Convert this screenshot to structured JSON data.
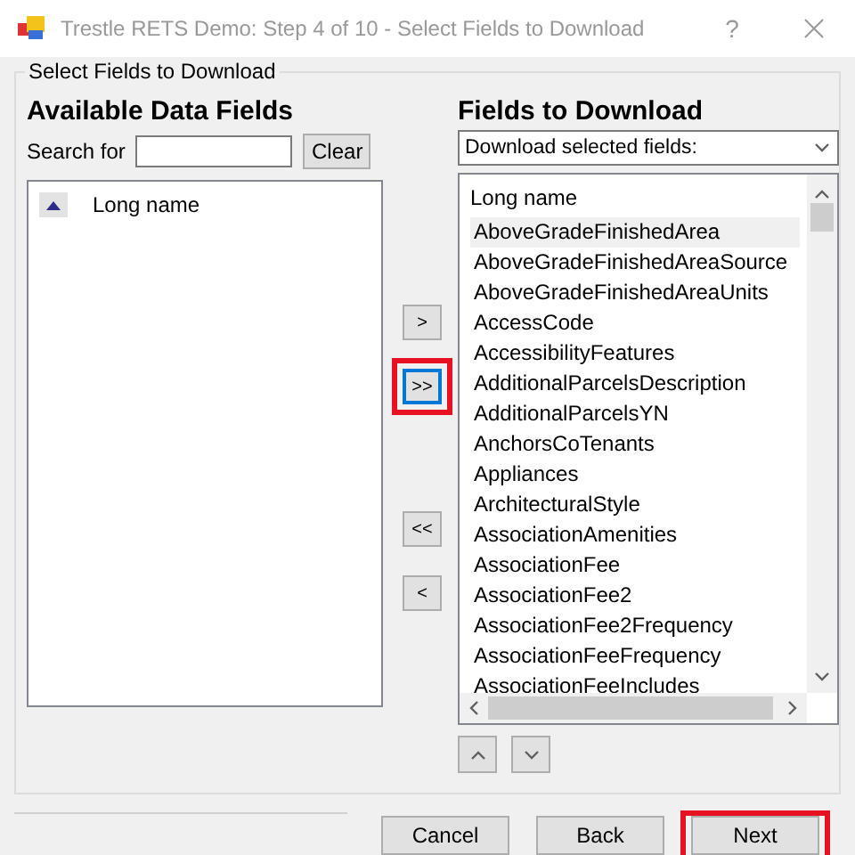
{
  "window": {
    "title": "Trestle RETS Demo: Step 4 of 10 - Select Fields to Download",
    "help": "?"
  },
  "group": {
    "label": "Select Fields to Download"
  },
  "available": {
    "heading": "Available Data Fields",
    "search_label": "Search for",
    "clear_button": "Clear",
    "column": "Long name"
  },
  "transfer_buttons": [
    {
      "label": ">",
      "focused": false,
      "highlighted": false
    },
    {
      "label": ">>",
      "focused": true,
      "highlighted": true
    },
    {
      "label": "<<",
      "focused": false,
      "highlighted": false
    },
    {
      "label": "<",
      "focused": false,
      "highlighted": false
    }
  ],
  "download": {
    "heading": "Fields to Download",
    "dropdown": "Download selected fields:",
    "column": "Long name",
    "rows": [
      {
        "name": "AboveGradeFinishedArea",
        "selected": true
      },
      {
        "name": "AboveGradeFinishedAreaSource",
        "selected": false
      },
      {
        "name": "AboveGradeFinishedAreaUnits",
        "selected": false
      },
      {
        "name": "AccessCode",
        "selected": false
      },
      {
        "name": "AccessibilityFeatures",
        "selected": false
      },
      {
        "name": "AdditionalParcelsDescription",
        "selected": false
      },
      {
        "name": "AdditionalParcelsYN",
        "selected": false
      },
      {
        "name": "AnchorsCoTenants",
        "selected": false
      },
      {
        "name": "Appliances",
        "selected": false
      },
      {
        "name": "ArchitecturalStyle",
        "selected": false
      },
      {
        "name": "AssociationAmenities",
        "selected": false
      },
      {
        "name": "AssociationFee",
        "selected": false
      },
      {
        "name": "AssociationFee2",
        "selected": false
      },
      {
        "name": "AssociationFee2Frequency",
        "selected": false
      },
      {
        "name": "AssociationFeeFrequency",
        "selected": false
      },
      {
        "name": "AssociationFeeIncludes",
        "selected": false
      }
    ]
  },
  "footer_buttons": [
    {
      "label": "Cancel",
      "highlighted": false
    },
    {
      "label": "Back",
      "highlighted": false
    },
    {
      "label": "Next",
      "highlighted": true
    }
  ]
}
